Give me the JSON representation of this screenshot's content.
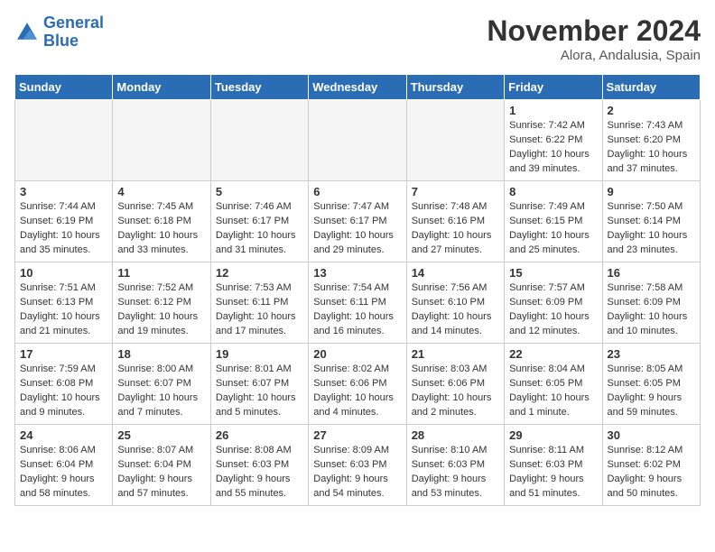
{
  "logo": {
    "line1": "General",
    "line2": "Blue"
  },
  "header": {
    "month": "November 2024",
    "location": "Alora, Andalusia, Spain"
  },
  "days_of_week": [
    "Sunday",
    "Monday",
    "Tuesday",
    "Wednesday",
    "Thursday",
    "Friday",
    "Saturday"
  ],
  "weeks": [
    [
      {
        "day": "",
        "info": ""
      },
      {
        "day": "",
        "info": ""
      },
      {
        "day": "",
        "info": ""
      },
      {
        "day": "",
        "info": ""
      },
      {
        "day": "",
        "info": ""
      },
      {
        "day": "1",
        "info": "Sunrise: 7:42 AM\nSunset: 6:22 PM\nDaylight: 10 hours and 39 minutes."
      },
      {
        "day": "2",
        "info": "Sunrise: 7:43 AM\nSunset: 6:20 PM\nDaylight: 10 hours and 37 minutes."
      }
    ],
    [
      {
        "day": "3",
        "info": "Sunrise: 7:44 AM\nSunset: 6:19 PM\nDaylight: 10 hours and 35 minutes."
      },
      {
        "day": "4",
        "info": "Sunrise: 7:45 AM\nSunset: 6:18 PM\nDaylight: 10 hours and 33 minutes."
      },
      {
        "day": "5",
        "info": "Sunrise: 7:46 AM\nSunset: 6:17 PM\nDaylight: 10 hours and 31 minutes."
      },
      {
        "day": "6",
        "info": "Sunrise: 7:47 AM\nSunset: 6:17 PM\nDaylight: 10 hours and 29 minutes."
      },
      {
        "day": "7",
        "info": "Sunrise: 7:48 AM\nSunset: 6:16 PM\nDaylight: 10 hours and 27 minutes."
      },
      {
        "day": "8",
        "info": "Sunrise: 7:49 AM\nSunset: 6:15 PM\nDaylight: 10 hours and 25 minutes."
      },
      {
        "day": "9",
        "info": "Sunrise: 7:50 AM\nSunset: 6:14 PM\nDaylight: 10 hours and 23 minutes."
      }
    ],
    [
      {
        "day": "10",
        "info": "Sunrise: 7:51 AM\nSunset: 6:13 PM\nDaylight: 10 hours and 21 minutes."
      },
      {
        "day": "11",
        "info": "Sunrise: 7:52 AM\nSunset: 6:12 PM\nDaylight: 10 hours and 19 minutes."
      },
      {
        "day": "12",
        "info": "Sunrise: 7:53 AM\nSunset: 6:11 PM\nDaylight: 10 hours and 17 minutes."
      },
      {
        "day": "13",
        "info": "Sunrise: 7:54 AM\nSunset: 6:11 PM\nDaylight: 10 hours and 16 minutes."
      },
      {
        "day": "14",
        "info": "Sunrise: 7:56 AM\nSunset: 6:10 PM\nDaylight: 10 hours and 14 minutes."
      },
      {
        "day": "15",
        "info": "Sunrise: 7:57 AM\nSunset: 6:09 PM\nDaylight: 10 hours and 12 minutes."
      },
      {
        "day": "16",
        "info": "Sunrise: 7:58 AM\nSunset: 6:09 PM\nDaylight: 10 hours and 10 minutes."
      }
    ],
    [
      {
        "day": "17",
        "info": "Sunrise: 7:59 AM\nSunset: 6:08 PM\nDaylight: 10 hours and 9 minutes."
      },
      {
        "day": "18",
        "info": "Sunrise: 8:00 AM\nSunset: 6:07 PM\nDaylight: 10 hours and 7 minutes."
      },
      {
        "day": "19",
        "info": "Sunrise: 8:01 AM\nSunset: 6:07 PM\nDaylight: 10 hours and 5 minutes."
      },
      {
        "day": "20",
        "info": "Sunrise: 8:02 AM\nSunset: 6:06 PM\nDaylight: 10 hours and 4 minutes."
      },
      {
        "day": "21",
        "info": "Sunrise: 8:03 AM\nSunset: 6:06 PM\nDaylight: 10 hours and 2 minutes."
      },
      {
        "day": "22",
        "info": "Sunrise: 8:04 AM\nSunset: 6:05 PM\nDaylight: 10 hours and 1 minute."
      },
      {
        "day": "23",
        "info": "Sunrise: 8:05 AM\nSunset: 6:05 PM\nDaylight: 9 hours and 59 minutes."
      }
    ],
    [
      {
        "day": "24",
        "info": "Sunrise: 8:06 AM\nSunset: 6:04 PM\nDaylight: 9 hours and 58 minutes."
      },
      {
        "day": "25",
        "info": "Sunrise: 8:07 AM\nSunset: 6:04 PM\nDaylight: 9 hours and 57 minutes."
      },
      {
        "day": "26",
        "info": "Sunrise: 8:08 AM\nSunset: 6:03 PM\nDaylight: 9 hours and 55 minutes."
      },
      {
        "day": "27",
        "info": "Sunrise: 8:09 AM\nSunset: 6:03 PM\nDaylight: 9 hours and 54 minutes."
      },
      {
        "day": "28",
        "info": "Sunrise: 8:10 AM\nSunset: 6:03 PM\nDaylight: 9 hours and 53 minutes."
      },
      {
        "day": "29",
        "info": "Sunrise: 8:11 AM\nSunset: 6:03 PM\nDaylight: 9 hours and 51 minutes."
      },
      {
        "day": "30",
        "info": "Sunrise: 8:12 AM\nSunset: 6:02 PM\nDaylight: 9 hours and 50 minutes."
      }
    ]
  ]
}
